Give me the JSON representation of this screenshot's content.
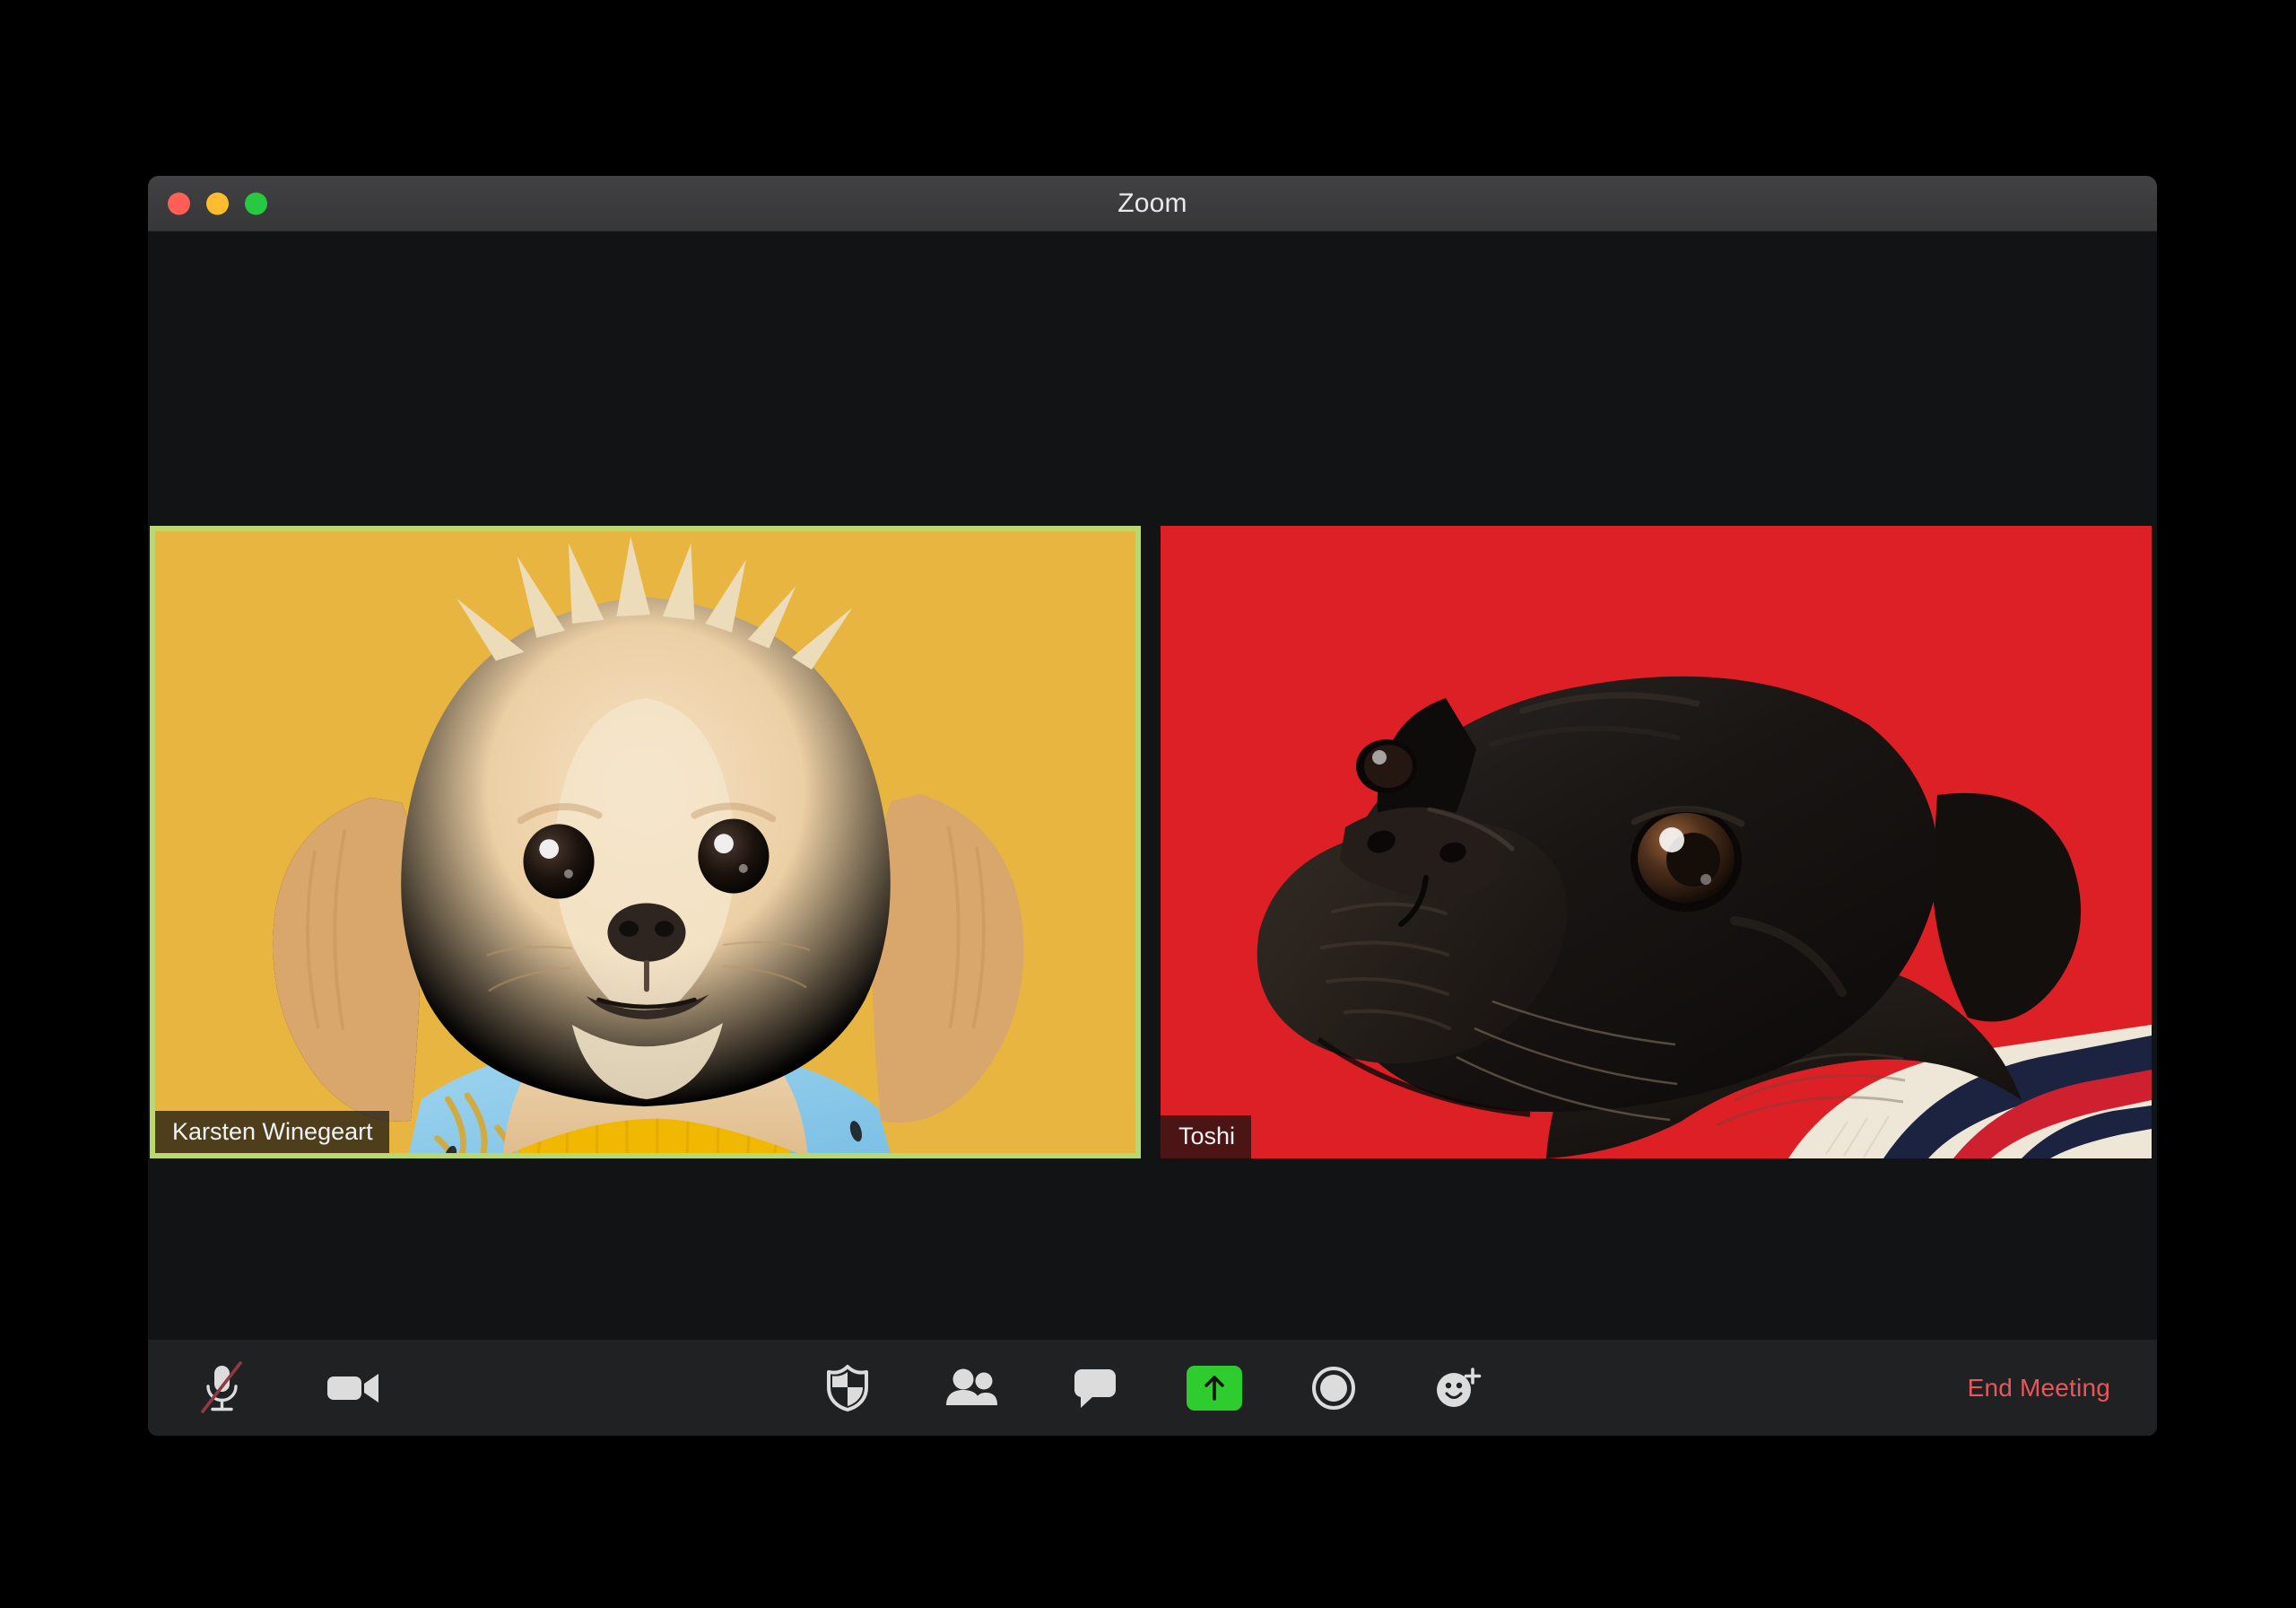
{
  "window": {
    "title": "Zoom",
    "traffic_lights": [
      {
        "name": "close",
        "color": "#ff5f57"
      },
      {
        "name": "minimize",
        "color": "#febc2e"
      },
      {
        "name": "zoom",
        "color": "#28c840"
      }
    ]
  },
  "meeting": {
    "layout": "gallery",
    "participant_count": 2,
    "active_speaker_border_color": "#b9d96e",
    "participants": [
      {
        "name": "Karsten Winegeart",
        "active_speaker": true,
        "background_color": "#e8b541",
        "video_description": "cream and apricot fluffy shih tzu mix dog wearing a light blue banana-print shirt over a yellow ribbed turtleneck",
        "muted": false
      },
      {
        "name": "Toshi",
        "active_speaker": false,
        "background_color": "#dc2026",
        "video_description": "black pug in three-quarter profile looking to the right, wearing a navy cream and red striped collar shirt",
        "muted": false
      }
    ]
  },
  "toolbar": {
    "background_color": "#1f2123",
    "controls": [
      {
        "icon": "microphone-muted-icon",
        "label": "Mute",
        "state": "muted",
        "group": "left"
      },
      {
        "icon": "video-camera-icon",
        "label": "Stop Video",
        "state": "on",
        "group": "left"
      },
      {
        "icon": "shield-icon",
        "label": "Security",
        "state": "default",
        "group": "center"
      },
      {
        "icon": "participants-icon",
        "label": "Participants",
        "state": "default",
        "group": "center"
      },
      {
        "icon": "chat-bubble-icon",
        "label": "Chat",
        "state": "default",
        "group": "center"
      },
      {
        "icon": "share-screen-icon",
        "label": "Share Screen",
        "state": "highlighted",
        "group": "center",
        "accent_color": "#2ecc2e"
      },
      {
        "icon": "record-icon",
        "label": "Record",
        "state": "default",
        "group": "center"
      },
      {
        "icon": "reactions-icon",
        "label": "Reactions",
        "state": "default",
        "group": "center"
      }
    ],
    "end_meeting_label": "End Meeting",
    "end_meeting_color": "#e8575b"
  }
}
